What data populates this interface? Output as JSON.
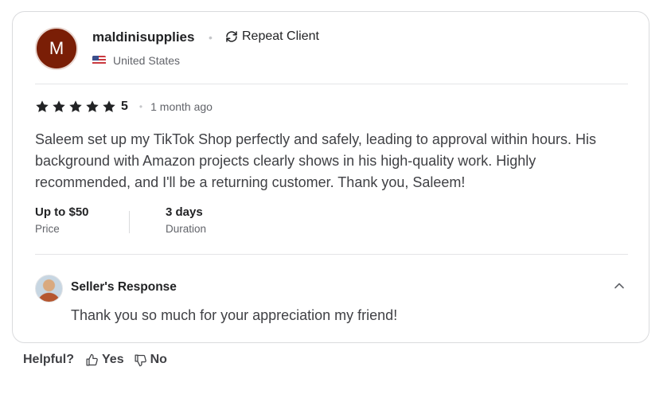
{
  "review": {
    "avatar_initial": "M",
    "username": "maldinisupplies",
    "repeat_label": "Repeat Client",
    "country": "United States",
    "rating_value": "5",
    "stars_filled": 5,
    "time_ago": "1 month ago",
    "text": "Saleem set up my TikTok Shop perfectly and safely, leading to approval within hours. His background with Amazon projects clearly shows in his high-quality work. Highly recommended, and I'll be a returning customer. Thank you, Saleem!",
    "price_value": "Up to $50",
    "price_label": "Price",
    "duration_value": "3 days",
    "duration_label": "Duration"
  },
  "seller_response": {
    "title": "Seller's Response",
    "text": "Thank you so much for your appreciation my friend!"
  },
  "helpful": {
    "label": "Helpful?",
    "yes": "Yes",
    "no": "No"
  },
  "colors": {
    "avatar_bg": "#7a1e06",
    "text_primary": "#222325",
    "text_secondary": "#62646a",
    "border": "#dadbdd"
  }
}
